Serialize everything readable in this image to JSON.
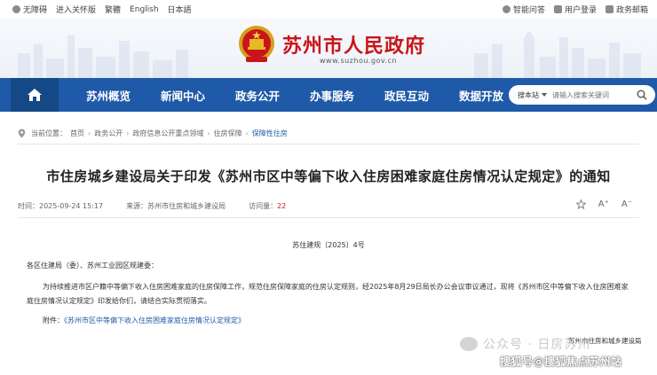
{
  "topbar": {
    "left": [
      {
        "label": "无障碍",
        "icon": "accessibility-icon"
      },
      {
        "label": "进入关怀版",
        "icon": ""
      },
      {
        "label": "繁體",
        "icon": ""
      },
      {
        "label": "English",
        "icon": ""
      },
      {
        "label": "日本語",
        "icon": ""
      }
    ],
    "right": [
      {
        "label": "智能问答",
        "icon": "robot-icon"
      },
      {
        "label": "用户登录",
        "icon": "user-icon"
      },
      {
        "label": "政务邮箱",
        "icon": "mail-icon"
      }
    ]
  },
  "header": {
    "site_title": "苏州市人民政府",
    "site_url": "www.suzhou.gov.cn"
  },
  "nav": {
    "items": [
      "苏州概览",
      "新闻中心",
      "政务公开",
      "办事服务",
      "政民互动",
      "数据开放"
    ],
    "search_scope": "搜本站",
    "search_placeholder": "请输入搜索关键词"
  },
  "breadcrumb": {
    "prefix": "当前位置：",
    "items": [
      "首页",
      "政务公开",
      "政府信息公开重点领域",
      "住房保障",
      "保障性住房"
    ]
  },
  "article": {
    "title": "市住房城乡建设局关于印发《苏州市区中等偏下收入住房困难家庭住房情况认定规定》的通知",
    "time_label": "时间：",
    "time": "2025-09-24 15:17",
    "source_label": "来源：",
    "source": "苏州市住房和城乡建设局",
    "views_label": "访问量：",
    "views": "22",
    "font_up": "A⁺",
    "font_down": "A⁻",
    "doc_number": "苏住建规〔2025〕4号",
    "salutation": "各区住建局（委）、苏州工业园区规建委：",
    "body_line1": "为持续推进市区户籍中等偏下收入住房困难家庭的住房保障工作，规范住房保障家庭的住房认定规则，经2025年8月29日局长办公会议审议通过，现将《苏州市区中等偏下收入住房困难家",
    "body_line2": "庭住房情况认定规定》印发给你们，请结合实际贯彻落实。",
    "attach_label": "附件：",
    "attach_link": "《苏州市区中等偏下收入住房困难家庭住房情况认定规定》",
    "signature": "苏州市住房和城乡建设局"
  },
  "watermarks": {
    "wechat": "公众号 · 日房苏州",
    "sohu": "搜狐号@搜狐焦点苏州站"
  },
  "colors": {
    "brand_red": "#c8151b",
    "nav_blue": "#1f5aa8",
    "nav_home": "#154886"
  }
}
